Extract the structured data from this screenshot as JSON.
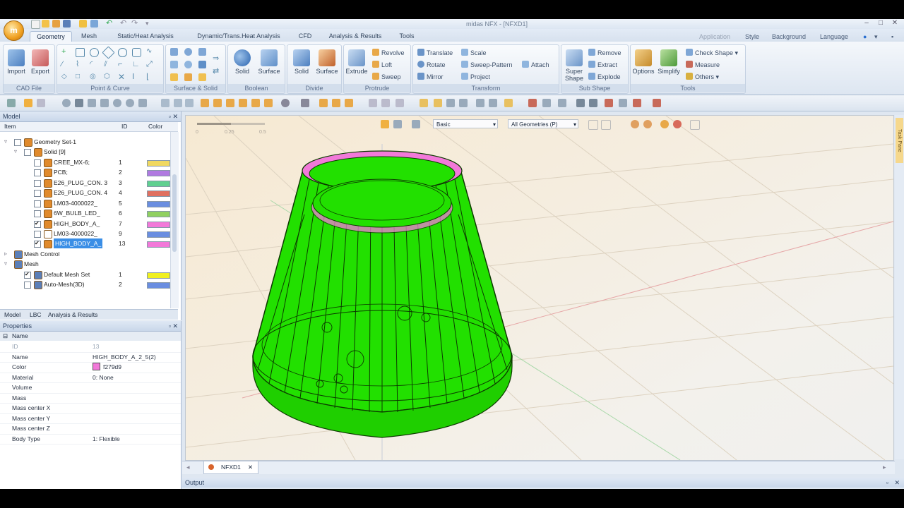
{
  "window": {
    "title": "midas NFX - [NFXD1]"
  },
  "tabs": [
    "Geometry",
    "Mesh",
    "Static/Heat Analysis",
    "Dynamic/Trans.Heat Analysis",
    "CFD",
    "Analysis & Results",
    "Tools"
  ],
  "right_links": {
    "application": "Application",
    "style": "Style",
    "background": "Background",
    "language": "Language"
  },
  "ribbon": {
    "cad_file": {
      "label": "CAD File",
      "import": "Import",
      "export": "Export"
    },
    "point_curve": {
      "label": "Point & Curve"
    },
    "surface_solid": {
      "label": "Surface & Solid"
    },
    "boolean": {
      "label": "Boolean",
      "solid": "Solid",
      "surface": "Surface"
    },
    "divide": {
      "label": "Divide",
      "solid": "Solid",
      "surface": "Surface"
    },
    "protrude": {
      "label": "Protrude",
      "extrude": "Extrude",
      "revolve": "Revolve",
      "loft": "Loft",
      "sweep": "Sweep"
    },
    "transform": {
      "label": "Transform",
      "translate": "Translate",
      "rotate": "Rotate",
      "mirror": "Mirror",
      "scale": "Scale",
      "sweep_pattern": "Sweep-Pattern",
      "project": "Project",
      "attach": "Attach"
    },
    "sub_shape": {
      "label": "Sub Shape",
      "super_shape_1": "Super",
      "super_shape_2": "Shape",
      "remove": "Remove",
      "extract": "Extract",
      "explode": "Explode"
    },
    "tools": {
      "label": "Tools",
      "options": "Options",
      "simplify": "Simplify",
      "check_shape": "Check Shape",
      "measure": "Measure",
      "others": "Others"
    }
  },
  "model_panel": {
    "title": "Model",
    "columns": {
      "item": "Item",
      "id": "ID",
      "color": "Color"
    },
    "rows": [
      {
        "label": "Geometry Set-1",
        "id": "",
        "color": ""
      },
      {
        "label": "Solid [9]",
        "id": "",
        "color": ""
      },
      {
        "label": "CREE_MX-6;",
        "id": "1",
        "color": "#f0d860"
      },
      {
        "label": "PCB;",
        "id": "2",
        "color": "#b07ae0"
      },
      {
        "label": "E26_PLUG_CON. 3",
        "id": "3",
        "color": "#60d090"
      },
      {
        "label": "E26_PLUG_CON. 4",
        "id": "4",
        "color": "#e07060"
      },
      {
        "label": "LM03-4000022_",
        "id": "5",
        "color": "#6a8ee0"
      },
      {
        "label": "6W_BULB_LED_",
        "id": "6",
        "color": "#90d060"
      },
      {
        "label": "HIGH_BODY_A_",
        "id": "7",
        "color": "#f279d9"
      },
      {
        "label": "LM03-4000022_",
        "id": "9",
        "color": "#6a8ee0"
      },
      {
        "label": "HIGH_BODY_A_",
        "id": "13",
        "color": "#f279d9"
      },
      {
        "label": "Mesh Control",
        "id": "",
        "color": ""
      },
      {
        "label": "Mesh",
        "id": "",
        "color": ""
      },
      {
        "label": "Default Mesh Set",
        "id": "1",
        "color": "#f0f020"
      },
      {
        "label": "Auto-Mesh(3D)",
        "id": "2",
        "color": "#6a8ee0"
      }
    ],
    "bottom_tabs": [
      "Model",
      "LBC",
      "Analysis & Results"
    ]
  },
  "properties_panel": {
    "title": "Properties",
    "section": "Name",
    "rows": [
      {
        "key": "ID",
        "value": "13"
      },
      {
        "key": "Name",
        "value": "HIGH_BODY_A_2_5(2)"
      },
      {
        "key": "Color",
        "value": "f279d9"
      },
      {
        "key": "Material",
        "value": "0: None"
      },
      {
        "key": "Volume",
        "value": ""
      },
      {
        "key": "Mass",
        "value": ""
      },
      {
        "key": "Mass center X",
        "value": ""
      },
      {
        "key": "Mass center Y",
        "value": ""
      },
      {
        "key": "Mass center Z",
        "value": ""
      },
      {
        "key": "Body Type",
        "value": "1: Flexible"
      }
    ]
  },
  "viewport": {
    "render_mode": "Basic",
    "filter": "All Geometries (P)",
    "model_color": "#22e000",
    "highlight_color": "#f279d9",
    "scale_ticks": [
      "0",
      "0.25",
      "0.5"
    ]
  },
  "doc_tab": "NFXD1",
  "output_label": "Output",
  "task_pane_label": "Task Pane"
}
